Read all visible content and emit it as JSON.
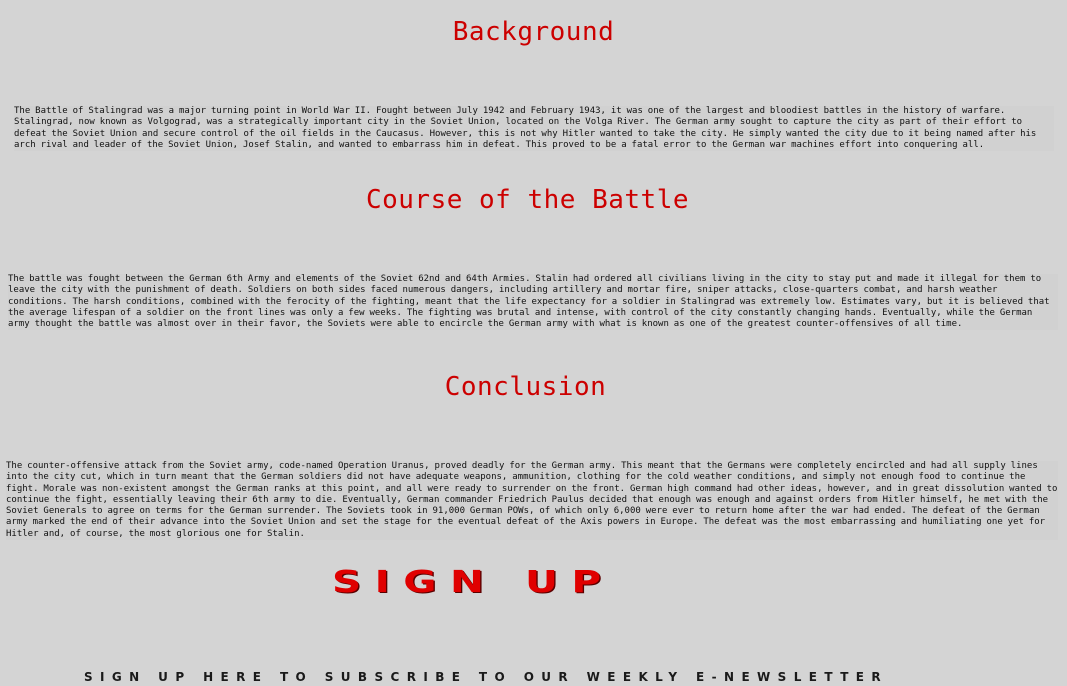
{
  "sections": {
    "background": {
      "heading": "Background",
      "text": "The Battle of Stalingrad was a major turning point in World War II. Fought between July 1942 and February 1943, it was one of the largest and bloodiest battles in the history of warfare. Stalingrad, now known as Volgograd, was a strategically important city in the Soviet Union, located on the Volga River. The German army sought to capture the city as part of their effort to defeat the Soviet Union and secure control of the oil fields in the Caucasus. However, this is not why Hitler wanted to take the city. He simply wanted the city due to it being named after his arch rival and leader of the Soviet Union, Josef Stalin, and wanted to embarrass him in defeat. This proved to be a fatal error to the German war machines effort into conquering all."
    },
    "course": {
      "heading": "Course of the Battle",
      "text": "The battle was fought between the German 6th Army and elements of the Soviet 62nd and 64th Armies. Stalin had ordered all civilians living in the city to stay put and made it illegal for them to leave the city with the punishment of death. Soldiers on both sides faced numerous dangers, including artillery and mortar fire, sniper attacks, close-quarters combat, and harsh weather conditions. The harsh conditions, combined with the ferocity of the fighting, meant that the life expectancy for a soldier in Stalingrad was extremely low. Estimates vary, but it is believed that the average lifespan of a soldier on the front lines was only a few weeks. The fighting was brutal and intense, with control of the city constantly changing hands. Eventually, while the German army thought the battle was almost over in their favor, the Soviets were able to encircle the German army with what is known as one of the greatest counter-offensives of all time."
    },
    "conclusion": {
      "heading": "Conclusion",
      "text": "The counter-offensive attack from the Soviet army, code-named Operation Uranus, proved deadly for the German army. This meant that the Germans were completely encircled and had all supply lines into the city cut, which in turn meant that the German soldiers did not have adequate weapons, ammunition, clothing for the cold weather conditions, and simply not enough food to continue the fight. Morale was non-existent amongst the German ranks at this point, and all were ready to surrender on the front. German high command had other ideas, however, and in great dissolution wanted to continue the fight, essentially leaving their 6th army to die. Eventually, German commander Friedrich Paulus decided that enough was enough and against orders from Hitler himself, he met with the Soviet Generals to agree on terms for the German surrender. The Soviets took in 91,000 German POWs, of which only 6,000 were ever to return home after the war had ended. The defeat of the German army marked the end of their advance into the Soviet Union and set the stage for the eventual defeat of the Axis powers in Europe. The defeat was the most embarrassing and humiliating one yet for Hitler and, of course, the most glorious one for Stalin."
    }
  },
  "signup": {
    "button_label": "SIGN UP",
    "subtext": "SIGN UP HERE TO SUBSCRIBE TO OUR WEEKLY E-NEWSLETTER"
  },
  "colors": {
    "background": "#d4d4d4",
    "heading": "#cc0000",
    "signup": "#e00000"
  }
}
